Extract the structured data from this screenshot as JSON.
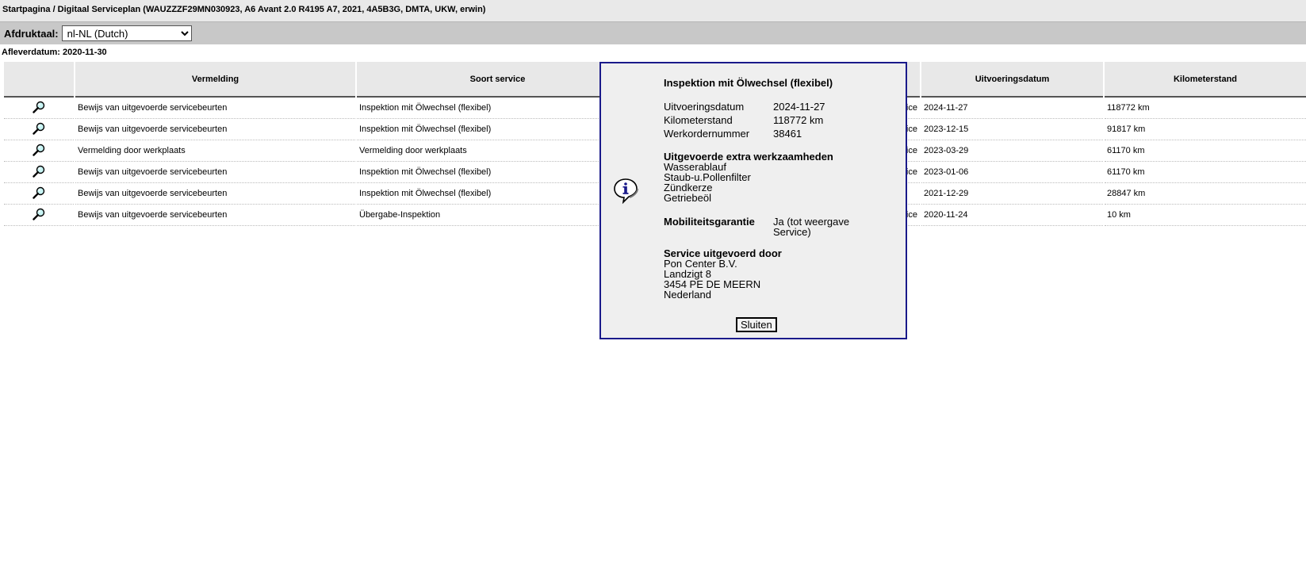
{
  "breadcrumb": "Startpagina / Digitaal Serviceplan (WAUZZZF29MN030923, A6 Avant 2.0 R4195 A7, 2021, 4A5B3G, DMTA, UKW, erwin)",
  "language": {
    "label": "Afdruktaal:",
    "selected": "nl-NL (Dutch)"
  },
  "delivery_date": "Afleverdatum: 2020-11-30",
  "table": {
    "headers": {
      "vermelding": "Vermelding",
      "soort": "Soort service",
      "uitvoeringsdatum": "Uitvoeringsdatum",
      "kilometerstand": "Kilometerstand"
    },
    "rows": [
      {
        "vermelding": "Bewijs van uitgevoerde servicebeurten",
        "soort": "Inspektion mit Ölwechsel (flexibel)",
        "dealer": "Audi Service",
        "datum": "2024-11-27",
        "km": "118772 km"
      },
      {
        "vermelding": "Bewijs van uitgevoerde servicebeurten",
        "soort": "Inspektion mit Ölwechsel (flexibel)",
        "dealer": "Audi Service",
        "datum": "2023-12-15",
        "km": "91817 km"
      },
      {
        "vermelding": "Vermelding door werkplaats",
        "soort": "Vermelding door werkplaats",
        "dealer": "Audi Service",
        "datum": "2023-03-29",
        "km": "61170 km"
      },
      {
        "vermelding": "Bewijs van uitgevoerde servicebeurten",
        "soort": "Inspektion mit Ölwechsel (flexibel)",
        "dealer": "Audi Service",
        "datum": "2023-01-06",
        "km": "61170 km"
      },
      {
        "vermelding": "Bewijs van uitgevoerde servicebeurten",
        "soort": "Inspektion mit Ölwechsel (flexibel)",
        "dealer": "",
        "datum": "2021-12-29",
        "km": "28847 km"
      },
      {
        "vermelding": "Bewijs van uitgevoerde servicebeurten",
        "soort": "Übergabe-Inspektion",
        "dealer": "Audi Service",
        "datum": "2020-11-24",
        "km": "10 km"
      }
    ]
  },
  "dialog": {
    "title": "Inspektion mit Ölwechsel (flexibel)",
    "details": [
      {
        "key": "Uitvoeringsdatum",
        "value": "2024-11-27"
      },
      {
        "key": "Kilometerstand",
        "value": "118772 km"
      },
      {
        "key": "Werkordernummer",
        "value": "38461"
      }
    ],
    "extra_heading": "Uitgevoerde extra werkzaamheden",
    "extra_items": [
      "Wasserablauf",
      "Staub-u.Pollenfilter",
      "Zündkerze",
      "Getriebeöl"
    ],
    "mobility_label": "Mobiliteitsgarantie",
    "mobility_value": "Ja (tot weergave Service)",
    "service_heading": "Service uitgevoerd door",
    "service_lines": [
      "Pon Center B.V.",
      "Landzigt 8",
      "3454 PE DE MEERN",
      "Nederland"
    ],
    "close_label": "Sluiten"
  }
}
